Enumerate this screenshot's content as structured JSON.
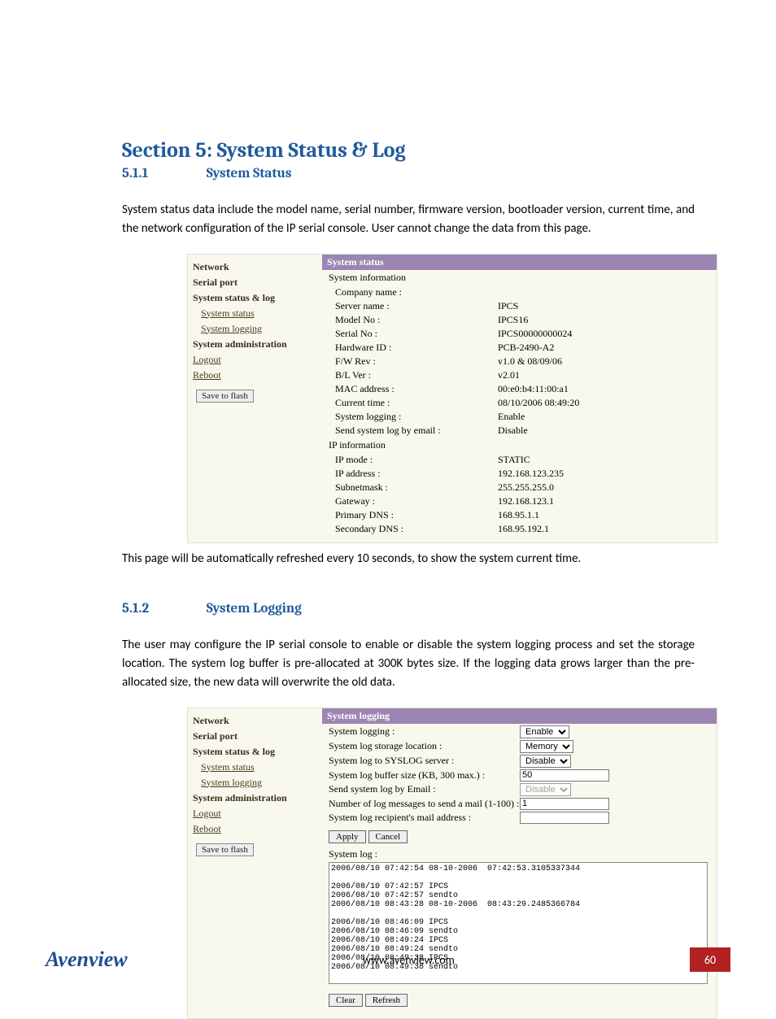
{
  "section_title": "Section 5: System Status & Log",
  "sub1": {
    "num": "5.1.1",
    "title": "System Status"
  },
  "para1": "System status data include the model name, serial number, firmware version, bootloader version, current time, and the network configuration of the IP serial console. User cannot change the data from this page.",
  "para2": "This page will be automatically refreshed every 10 seconds, to show the system current time.",
  "sub2": {
    "num": "5.1.2",
    "title": "System Logging"
  },
  "para3": "The user may configure the IP serial console to enable or disable the system logging process and set the storage location. The system log buffer is pre-allocated at 300K bytes size. If the logging data grows larger than the pre-allocated size, the new data will overwrite the old data.",
  "sidebar": {
    "network": "Network",
    "serial_port": "Serial port",
    "status_log": "System status & log",
    "system_status": "System status",
    "system_logging": "System logging",
    "system_admin": "System administration",
    "logout": "Logout",
    "reboot": "Reboot",
    "save_btn": "Save to flash"
  },
  "status_panel": {
    "title": "System status",
    "group1": "System information",
    "rows1": [
      {
        "k": "Company name :",
        "v": ""
      },
      {
        "k": "Server name :",
        "v": "IPCS"
      },
      {
        "k": "Model No :",
        "v": "IPCS16"
      },
      {
        "k": "Serial No :",
        "v": "IPCS00000000024"
      },
      {
        "k": "Hardware ID :",
        "v": "PCB-2490-A2"
      },
      {
        "k": "F/W Rev :",
        "v": "v1.0 & 08/09/06"
      },
      {
        "k": "B/L Ver :",
        "v": "v2.01"
      },
      {
        "k": "MAC address :",
        "v": "00:e0:b4:11:00:a1"
      },
      {
        "k": "Current time :",
        "v": "08/10/2006 08:49:20"
      },
      {
        "k": "System logging :",
        "v": "Enable"
      },
      {
        "k": "Send system log by email :",
        "v": "Disable"
      }
    ],
    "group2": "IP information",
    "rows2": [
      {
        "k": "IP mode :",
        "v": "STATIC"
      },
      {
        "k": "IP address :",
        "v": "192.168.123.235"
      },
      {
        "k": "Subnetmask :",
        "v": "255.255.255.0"
      },
      {
        "k": "Gateway :",
        "v": "192.168.123.1"
      },
      {
        "k": "Primary DNS :",
        "v": "168.95.1.1"
      },
      {
        "k": "Secondary DNS :",
        "v": "168.95.192.1"
      }
    ]
  },
  "logging_panel": {
    "title": "System logging",
    "f1": {
      "lbl": "System logging :",
      "val": "Enable"
    },
    "f2": {
      "lbl": "System log storage location :",
      "val": "Memory"
    },
    "f3": {
      "lbl": "System log to SYSLOG server :",
      "val": "Disable"
    },
    "f4": {
      "lbl": "System log buffer size (KB, 300 max.) :",
      "val": "50"
    },
    "f5": {
      "lbl": "Send system log by Email :",
      "val": "Disable"
    },
    "f6": {
      "lbl": "Number of log messages to send a mail (1-100) :",
      "val": "1"
    },
    "f7": {
      "lbl": "System log recipient's mail address :",
      "val": ""
    },
    "apply": "Apply",
    "cancel": "Cancel",
    "log_label": "System log :",
    "log_text": "2006/08/10 07:42:54 08-10-2006  07:42:53.3105337344\n\n2006/08/10 07:42:57 IPCS\n2006/08/10 07:42:57 sendto\n2006/08/10 08:43:28 08-10-2006  08:43:29.2485366784\n\n2006/08/10 08:46:09 IPCS\n2006/08/10 08:46:09 sendto\n2006/08/10 08:49:24 IPCS\n2006/08/10 08:49:24 sendto\n2006/08/10 08:49:38 IPCS\n2006/08/10 08:49:38 sendto",
    "clear": "Clear",
    "refresh": "Refresh"
  },
  "footer": {
    "brand": "Avenview",
    "url": "www.avenview.com",
    "page": "60"
  }
}
